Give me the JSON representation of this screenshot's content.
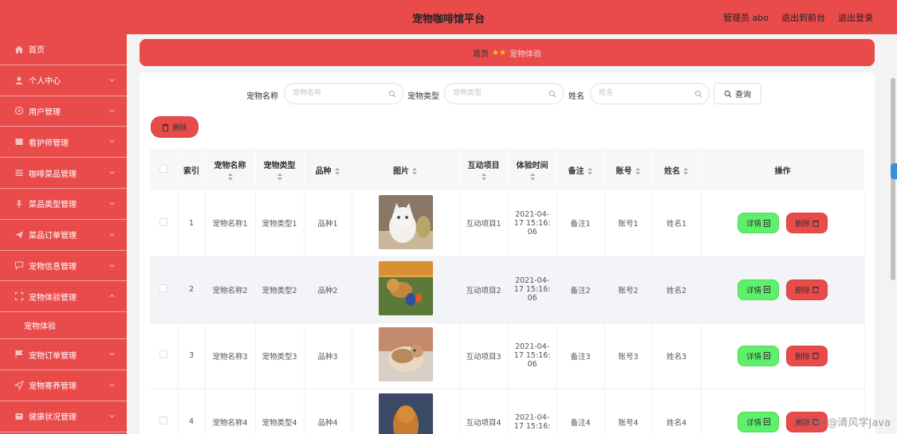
{
  "header": {
    "title": "宠物咖啡馆平台",
    "admin": "管理员 abo",
    "backend": "退出到前台",
    "logout": "退出登录"
  },
  "sidebar": {
    "items": [
      {
        "label": "首页",
        "icon": "home-icon",
        "chevron": false
      },
      {
        "label": "个人中心",
        "icon": "user-icon",
        "chevron": true
      },
      {
        "label": "用户管理",
        "icon": "users-icon",
        "chevron": true
      },
      {
        "label": "看护师管理",
        "icon": "caretaker-icon",
        "chevron": true
      },
      {
        "label": "咖啡菜品管理",
        "icon": "list-icon",
        "chevron": true
      },
      {
        "label": "菜品类型管理",
        "icon": "mic-icon",
        "chevron": true
      },
      {
        "label": "菜品订单管理",
        "icon": "send-icon",
        "chevron": true
      },
      {
        "label": "宠物信息管理",
        "icon": "chat-icon",
        "chevron": true
      },
      {
        "label": "宠物体验管理",
        "icon": "frame-icon",
        "chevron": true
      }
    ],
    "sub": {
      "label": "宠物体验"
    },
    "items2": [
      {
        "label": "宠物订单管理",
        "icon": "flag-icon"
      },
      {
        "label": "宠物寄养管理",
        "icon": "navigate-icon"
      },
      {
        "label": "健康状况管理",
        "icon": "doc-icon"
      }
    ]
  },
  "breadcrumb": {
    "home": "首页",
    "stars": "★★",
    "current": "宠物体验"
  },
  "search": {
    "name_label": "宠物名称",
    "name_placeholder": "宠物名称",
    "type_label": "宠物类型",
    "type_placeholder": "宠物类型",
    "person_label": "姓名",
    "person_placeholder": "姓名",
    "query": "查询"
  },
  "toolbar": {
    "delete": "删除"
  },
  "table": {
    "headers": {
      "index": "索引",
      "name": "宠物名称",
      "type": "宠物类型",
      "breed": "品种",
      "image": "图片",
      "activity": "互动项目",
      "time": "体验时间",
      "remark": "备注",
      "account": "账号",
      "person": "姓名",
      "actions": "操作"
    },
    "detail_label": "详情",
    "delete_label": "删除",
    "rows": [
      {
        "index": "1",
        "name": "宠物名称1",
        "type": "宠物类型1",
        "breed": "品种1",
        "activity": "互动项目1",
        "time1": "2021-04-",
        "time2": "17 15:16:",
        "time3": "06",
        "remark": "备注1",
        "account": "账号1",
        "person": "姓名1"
      },
      {
        "index": "2",
        "name": "宠物名称2",
        "type": "宠物类型2",
        "breed": "品种2",
        "activity": "互动项目2",
        "time1": "2021-04-",
        "time2": "17 15:16:",
        "time3": "06",
        "remark": "备注2",
        "account": "账号2",
        "person": "姓名2"
      },
      {
        "index": "3",
        "name": "宠物名称3",
        "type": "宠物类型3",
        "breed": "品种3",
        "activity": "互动项目3",
        "time1": "2021-04-",
        "time2": "17 15:16:",
        "time3": "06",
        "remark": "备注3",
        "account": "账号3",
        "person": "姓名3"
      },
      {
        "index": "4",
        "name": "宠物名称4",
        "type": "宠物类型4",
        "breed": "品种4",
        "activity": "互动项目4",
        "time1": "2021-04-",
        "time2": "17 15:16:",
        "time3": "",
        "remark": "备注4",
        "account": "账号4",
        "person": "姓名4"
      }
    ]
  },
  "watermark": "CSDN @清风学Java",
  "colors": {
    "primary": "#e94b4b",
    "success": "#5ef06a"
  }
}
